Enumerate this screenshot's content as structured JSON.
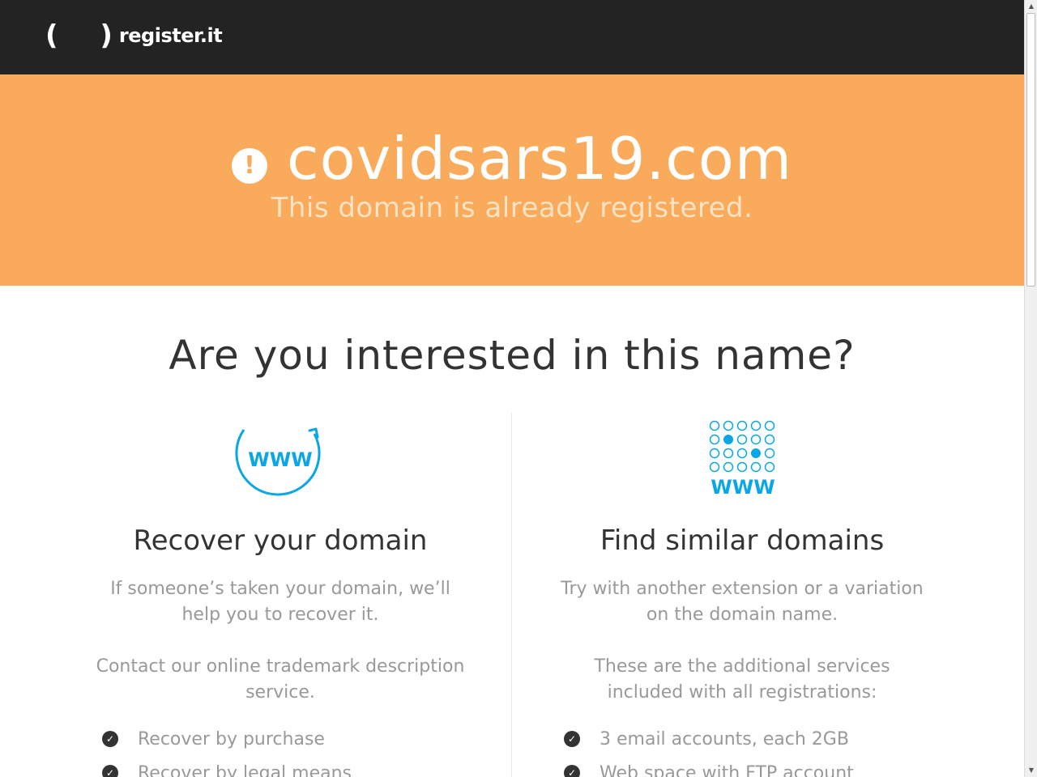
{
  "header": {
    "logo_parens": "( )",
    "logo_text": "register.it"
  },
  "hero": {
    "domain": "covidsars19.com",
    "subtitle": "This domain is already registered.",
    "alert_icon_glyph": "!"
  },
  "main": {
    "question": "Are you interested in this name?",
    "recover": {
      "icon_label": "WWW",
      "title": "Recover your domain",
      "text1": "If someone’s taken your domain, we’ll help you to recover it.",
      "text2": "Contact our online trademark description service.",
      "bullets": [
        "Recover by purchase",
        "Recover by legal means"
      ]
    },
    "similar": {
      "icon_label": "WWW",
      "title": "Find similar domains",
      "text1": "Try with another extension or a variation on the domain name.",
      "text2": "These are the additional services included with all registrations:",
      "bullets": [
        "3 email accounts, each 2GB",
        "Web space with FTP account"
      ]
    }
  },
  "colors": {
    "header_bg": "#232323",
    "hero_bg": "#f9aa5a",
    "icon_blue": "#0aa7e6",
    "text_dark": "#333333",
    "text_muted": "#999999"
  },
  "icons": {
    "alert": "exclamation-circle-icon",
    "recover": "www-refresh-icon",
    "similar": "www-dot-grid-icon",
    "bullet": "check-circle-icon"
  }
}
